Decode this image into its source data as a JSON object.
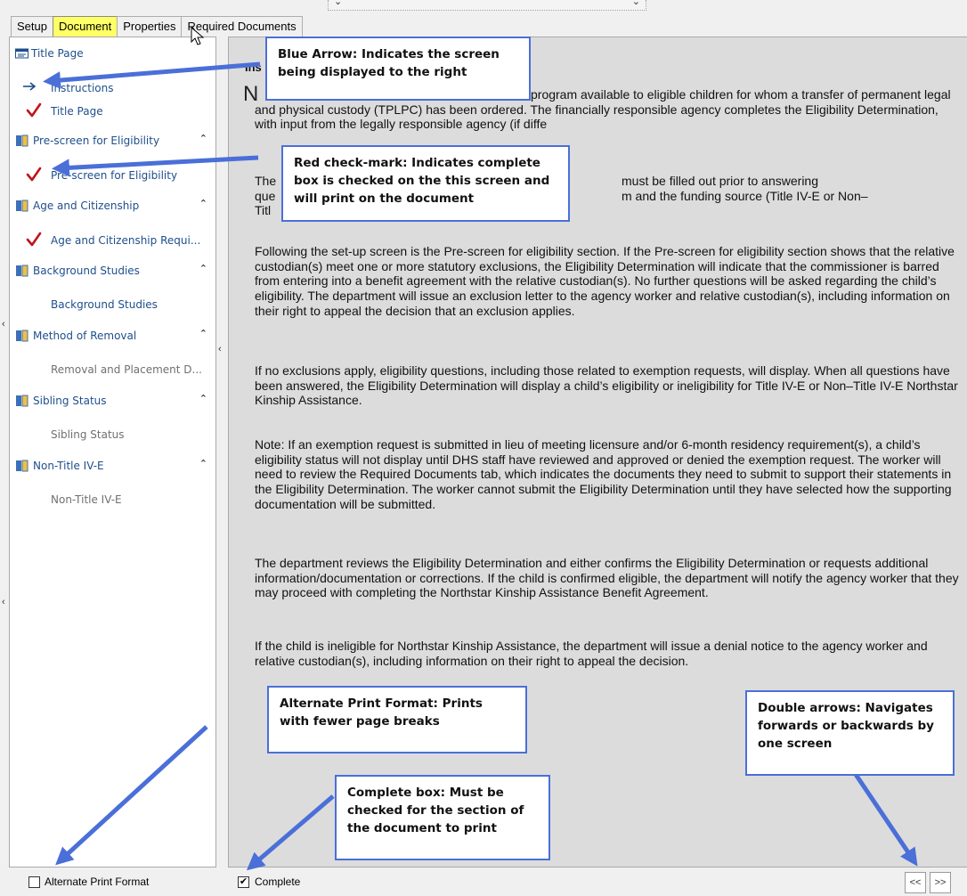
{
  "tabs": [
    "Setup",
    "Document",
    "Properties",
    "Required Documents"
  ],
  "nav": {
    "groups": {
      "title_page": "Title Page",
      "prescreen": "Pre-screen for Eligibility",
      "age": "Age and Citizenship",
      "background": "Background Studies",
      "removal": "Method of Removal",
      "sibling": "Sibling Status",
      "nontitle": "Non-Title IV-E"
    },
    "items": {
      "instructions": "Instructions",
      "title_page": "Title Page",
      "prescreen": "Pre-screen for Eligibility",
      "age": "Age and Citizenship Requi...",
      "background": "Background Studies",
      "removal": "Removal and Placement D...",
      "sibling": "Sibling Status",
      "nontitle": "Non-Title IV-E"
    }
  },
  "content": {
    "heading": "Ins",
    "big_letter": "N",
    "p1": "program available to eligible children for whom a transfer of permanent legal and physical custody (TPLPC) has been ordered. The financially responsible agency completes the Eligibility Determination, with input from the legally responsible agency (if diffe",
    "p2_line1": "The",
    "p2_line1_end": "must be filled out prior to answering",
    "p2_line2": "que",
    "p2_line2_end": "m and the funding source (Title IV-E or Non–",
    "p2_line3": "Titl",
    "p3": "Following the set-up screen is the Pre-screen for eligibility section. If the Pre-screen for eligibility section shows that the relative custodian(s) meet one or more statutory exclusions, the Eligibility Determination will indicate that the commissioner is barred from entering into a benefit agreement with the relative custodian(s). No further questions will be asked regarding the child’s eligibility. The department will issue an exclusion letter to the agency worker and relative custodian(s), including information on their right to appeal the decision that an exclusion applies.",
    "p4": "If no exclusions apply, eligibility questions, including those related to exemption requests, will display. When all questions have been answered, the Eligibility Determination will display a child’s eligibility or ineligibility for Title IV-E or Non–Title IV-E Northstar Kinship Assistance.",
    "p5": "Note: If an exemption request is submitted in lieu of meeting licensure and/or 6-month residency requirement(s), a child’s eligibility status will not display until DHS staff have reviewed and approved or denied the exemption request. The worker will need to review the Required Documents tab, which indicates the documents they need to submit to support their statements in the Eligibility Determination. The worker cannot submit the Eligibility Determination until they have selected how the supporting documentation will be submitted.",
    "p6": "The department reviews the Eligibility Determination and either confirms the Eligibility Determination or requests additional information/documentation or corrections. If the child is confirmed eligible, the department will notify the agency worker that they may proceed with completing the Northstar Kinship Assistance Benefit Agreement.",
    "p7": "If the child is ineligible for Northstar Kinship Assistance, the department will issue a denial notice to the agency worker and relative custodian(s), including information on their right to appeal the decision."
  },
  "callouts": {
    "blue_arrow": "Blue Arrow: Indicates the screen being displayed to the right",
    "red_check": "Red check-mark: Indicates complete box is checked on the this screen and will print on the document",
    "alt_print": "Alternate Print Format: Prints with fewer page breaks",
    "complete_box": "Complete box: Must be checked for the section of the document to print",
    "double_arrows": "Double arrows: Navigates forwards or backwards by one screen"
  },
  "bottom": {
    "alt_print_label": "Alternate Print Format",
    "alt_print_checked": false,
    "complete_label": "Complete",
    "complete_checked": true,
    "prev_label": "<<",
    "next_label": ">>"
  },
  "colors": {
    "active_tab": "#ffff66",
    "nav_text": "#1f4e8c",
    "check_red": "#c0141c",
    "arrow_blue": "#4a6fd8",
    "callout_border": "#4a6fd8"
  }
}
